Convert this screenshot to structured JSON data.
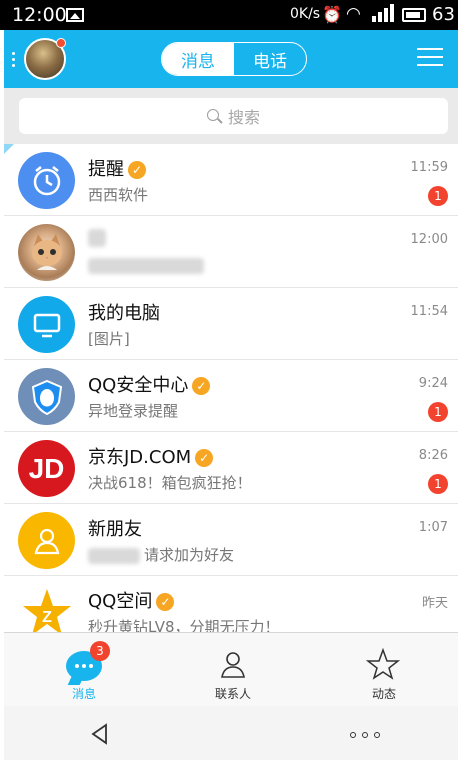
{
  "status_bar": {
    "time": "12:00",
    "network_speed": "0K/s",
    "battery": "63"
  },
  "header": {
    "tabs": [
      {
        "label": "消息",
        "active": true
      },
      {
        "label": "电话",
        "active": false
      }
    ]
  },
  "search": {
    "placeholder": "搜索"
  },
  "conversations": [
    {
      "name": "提醒",
      "verified": true,
      "preview": "西西软件",
      "time": "11:59",
      "unread": "1",
      "avatar": "alarm-clock-icon"
    },
    {
      "name": "",
      "verified": false,
      "preview": "",
      "time": "12:00",
      "unread": "",
      "avatar": "kitten-photo"
    },
    {
      "name": "我的电脑",
      "verified": false,
      "preview": "[图片]",
      "time": "11:54",
      "unread": "",
      "avatar": "computer-icon"
    },
    {
      "name": "QQ安全中心",
      "verified": true,
      "preview": "异地登录提醒",
      "time": "9:24",
      "unread": "1",
      "avatar": "shield-icon"
    },
    {
      "name": "京东JD.COM",
      "verified": true,
      "preview": "决战618！箱包疯狂抢！",
      "time": "8:26",
      "unread": "1",
      "avatar": "jd-logo"
    },
    {
      "name": "新朋友",
      "verified": false,
      "preview": "请求加为好友",
      "time": "1:07",
      "unread": "",
      "avatar": "person-icon"
    },
    {
      "name": "QQ空间",
      "verified": true,
      "preview": "秒升黄钻LV8，分期无压力！",
      "time": "昨天",
      "unread": "",
      "avatar": "star-icon"
    }
  ],
  "bottom_nav": [
    {
      "label": "消息",
      "badge": "3",
      "active": true,
      "icon": "message-icon"
    },
    {
      "label": "联系人",
      "badge": "",
      "active": false,
      "icon": "contacts-icon"
    },
    {
      "label": "动态",
      "badge": "",
      "active": false,
      "icon": "star-outline-icon"
    }
  ],
  "colors": {
    "accent": "#18b4ed",
    "badge": "#f2432e",
    "verified": "#f6a623"
  }
}
